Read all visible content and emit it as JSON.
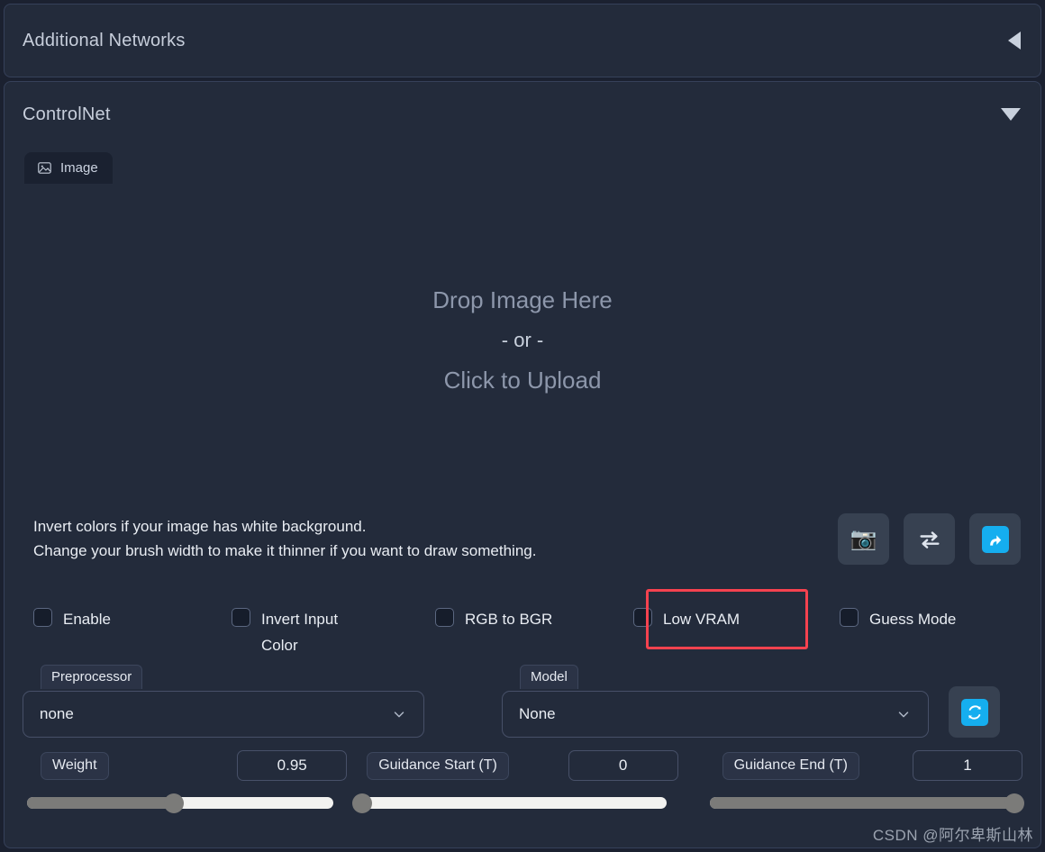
{
  "panels": {
    "additional_networks": {
      "title": "Additional Networks",
      "toggle_icon": "caret-left-icon"
    },
    "controlnet": {
      "title": "ControlNet",
      "toggle_icon": "caret-down-icon"
    }
  },
  "tabs": [
    {
      "label": "Image",
      "icon": "image-icon",
      "selected": true
    }
  ],
  "upload": {
    "drop_text": "Drop Image Here",
    "or_text": "- or -",
    "click_text": "Click to Upload"
  },
  "hints": {
    "line1": "Invert colors if your image has white background.",
    "line2": "Change your brush width to make it thinner if you want to draw something."
  },
  "icon_buttons": [
    {
      "name": "webcam-button",
      "icon": "camera-icon",
      "glyph": "📷"
    },
    {
      "name": "mirror-webcam-button",
      "icon": "swap-arrows-icon",
      "glyph": "⇄"
    },
    {
      "name": "send-dimensions-button",
      "icon": "arrow-heading-up-icon",
      "glyph": "⤴"
    }
  ],
  "checkboxes": [
    {
      "label": "Enable",
      "checked": false
    },
    {
      "label": "Invert Input Color",
      "checked": false
    },
    {
      "label": "RGB to BGR",
      "checked": false
    },
    {
      "label": "Low VRAM",
      "checked": false,
      "highlighted": true
    },
    {
      "label": "Guess Mode",
      "checked": false
    }
  ],
  "highlight_color": "#f5424f",
  "dropdowns": [
    {
      "label": "Preprocessor",
      "value": "none"
    },
    {
      "label": "Model",
      "value": "None"
    }
  ],
  "refresh_button": {
    "icon": "refresh-icon",
    "label": "🔄"
  },
  "sliders": [
    {
      "label": "Weight",
      "value": "0.95",
      "percent": 48
    },
    {
      "label": "Guidance Start (T)",
      "value": "0",
      "percent": 0
    },
    {
      "label": "Guidance End (T)",
      "value": "1",
      "percent": 100
    }
  ],
  "watermark": "CSDN @阿尔卑斯山林"
}
